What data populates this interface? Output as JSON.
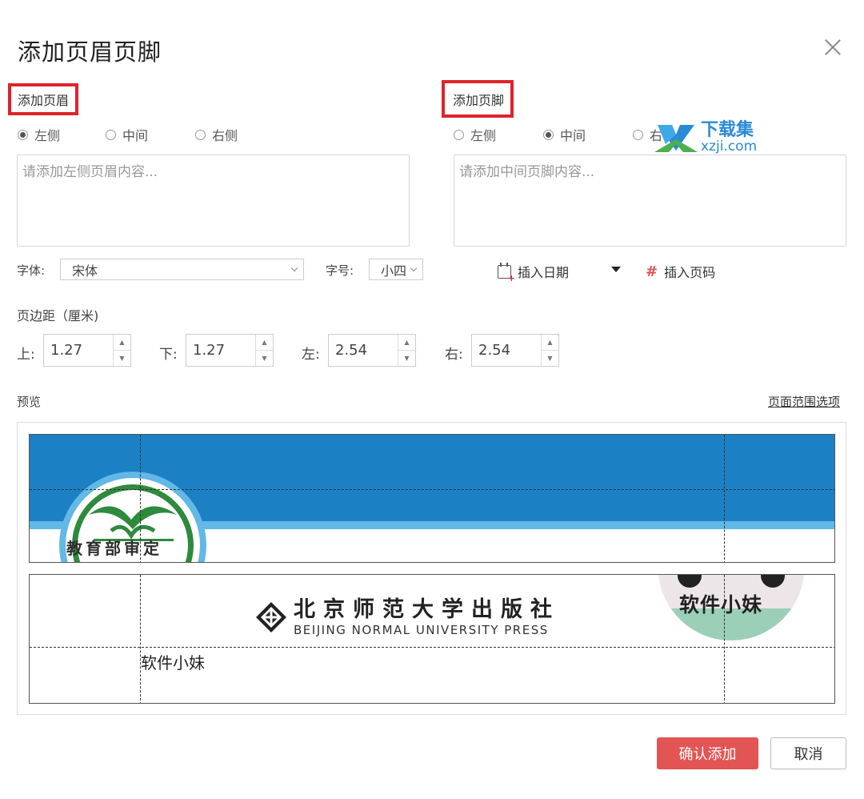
{
  "dialog": {
    "title": "添加页眉页脚"
  },
  "header": {
    "section_label": "添加页眉",
    "positions": [
      "左侧",
      "中间",
      "右侧"
    ],
    "selected": "左侧",
    "placeholder": "请添加左侧页眉内容...",
    "font_label": "字体:",
    "font_value": "宋体",
    "size_label": "字号:",
    "size_value": "小四"
  },
  "footer": {
    "section_label": "添加页脚",
    "positions": [
      "左侧",
      "中间",
      "右"
    ],
    "selected": "中间",
    "placeholder": "请添加中间页脚内容...",
    "insert_date": "插入日期",
    "insert_page": "插入页码"
  },
  "margins": {
    "title": "页边距（厘米)",
    "top_label": "上:",
    "top": "1.27",
    "bottom_label": "下:",
    "bottom": "1.27",
    "left_label": "左:",
    "left": "2.54",
    "right_label": "右:",
    "right": "2.54"
  },
  "preview": {
    "label": "预览",
    "range_link": "页面范围选项",
    "emblem_text": "教育部审定",
    "publisher_cn": "北京师范大学出版社",
    "publisher_en": "BEIJING NORMAL UNIVERSITY PRESS",
    "avatar_text": "软件小妹",
    "footer_text": "软件小妹"
  },
  "buttons": {
    "confirm": "确认添加",
    "cancel": "取消"
  },
  "watermark": {
    "line1": "下载集",
    "line2": "xzji.com"
  },
  "colors": {
    "accent_red": "#e0232b",
    "confirm_bg": "#e25554",
    "banner_blue": "#1b80c4",
    "light_blue": "#62b8e6",
    "emblem_green": "#2e8a3c",
    "avatar_teal": "#9ccfb8"
  }
}
